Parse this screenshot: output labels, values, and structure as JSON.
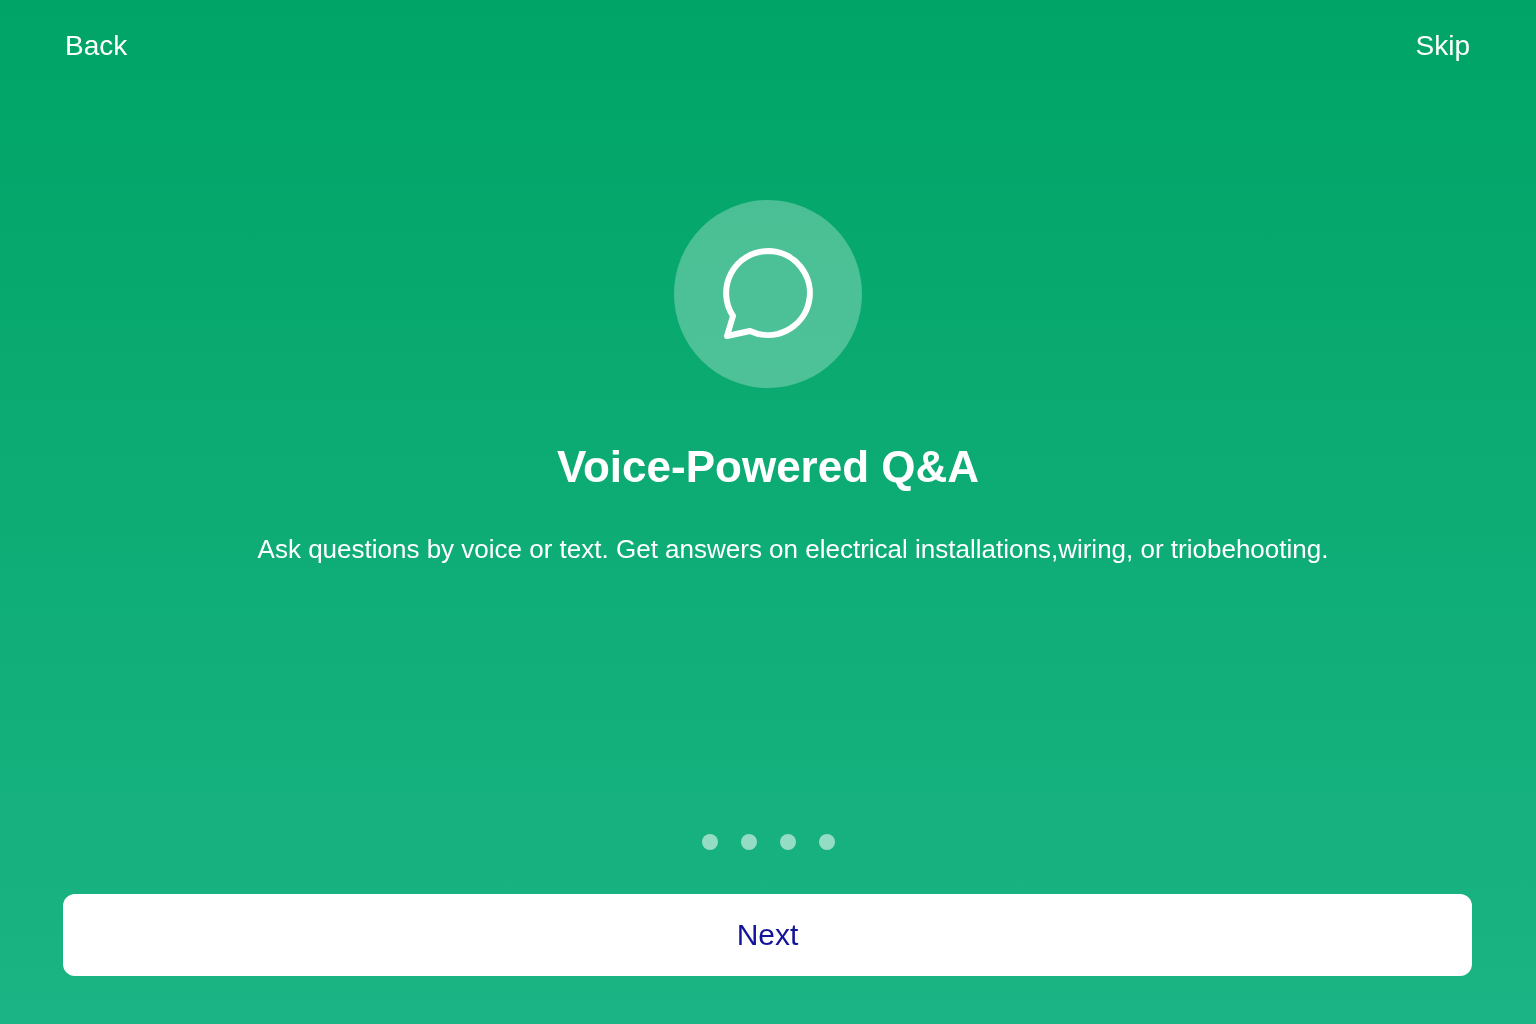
{
  "header": {
    "back": "Back",
    "skip": "Skip"
  },
  "feature": {
    "title": "Voice-Powered Q&A",
    "description": "Ask questions by voice or text. Get answers on electrical installations,wiring, or triobehooting."
  },
  "pager": [
    {
      "selected": false
    },
    {
      "selected": false
    },
    {
      "selected": false
    },
    {
      "selected": false
    }
  ],
  "button": "Next"
}
